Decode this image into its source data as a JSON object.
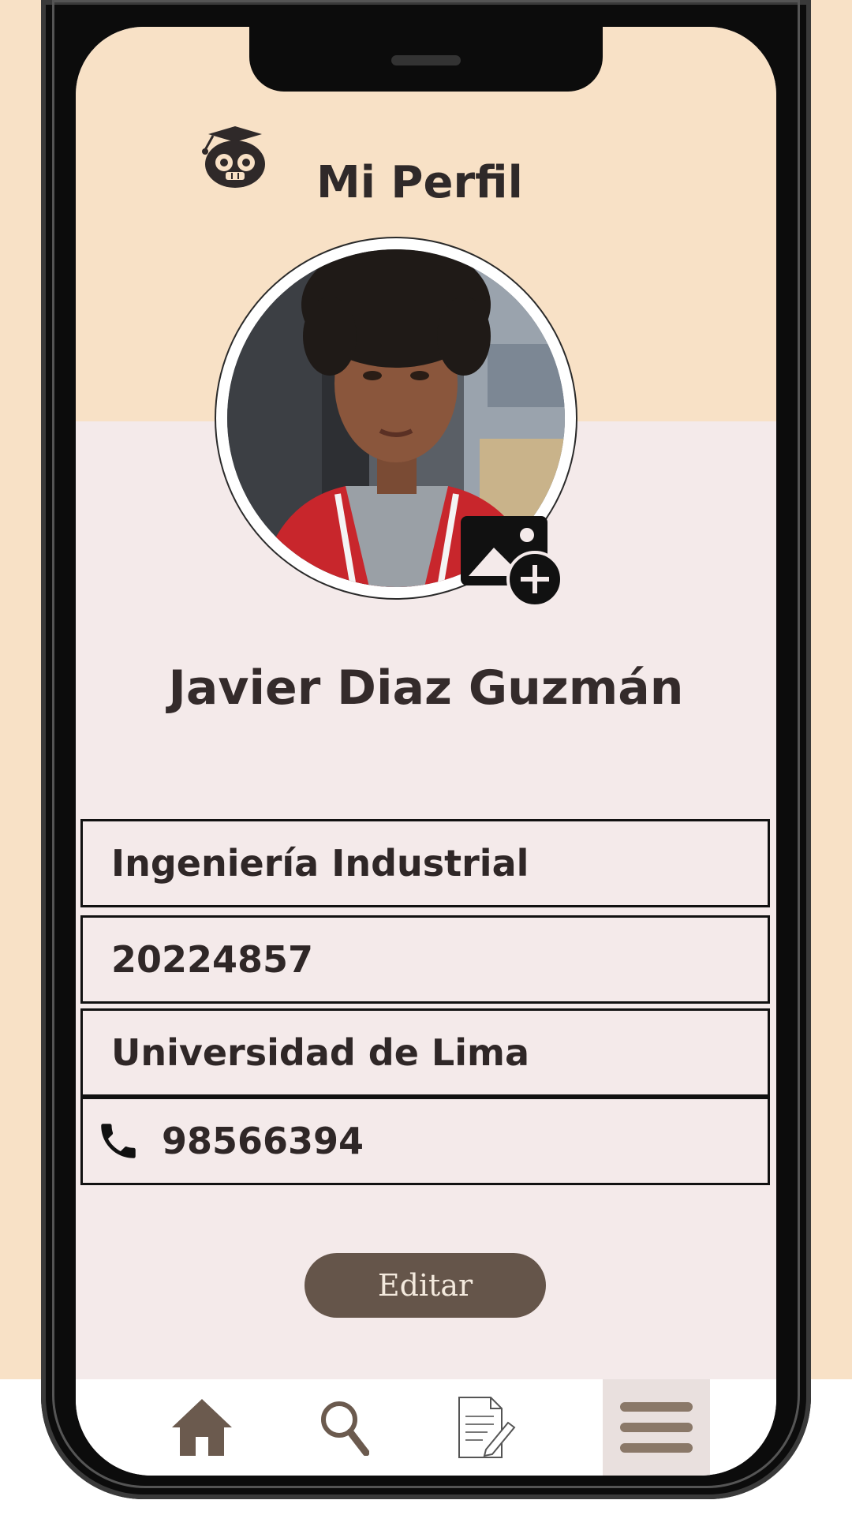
{
  "header": {
    "title": "Mi Perfil",
    "logo_icon": "owl-graduate-logo"
  },
  "profile": {
    "name": "Javier Diaz Guzmán",
    "avatar": "profile-photo",
    "add_photo_icon": "add-photo-icon"
  },
  "info": {
    "career": "Ingeniería Industrial",
    "student_code": "20224857",
    "university": "Universidad de Lima",
    "phone": "98566394",
    "phone_icon": "phone-icon"
  },
  "actions": {
    "edit_label": "Editar"
  },
  "bottom_nav": {
    "items": [
      {
        "icon": "home-icon"
      },
      {
        "icon": "search-icon"
      },
      {
        "icon": "document-edit-icon"
      },
      {
        "icon": "menu-icon",
        "active": true
      }
    ]
  },
  "colors": {
    "background_peach": "#f8e1c6",
    "screen_background": "#f4eaea",
    "text_dark": "#2f2929",
    "button_brown": "#65554a",
    "nav_icon_brown": "#6b5a4e"
  }
}
